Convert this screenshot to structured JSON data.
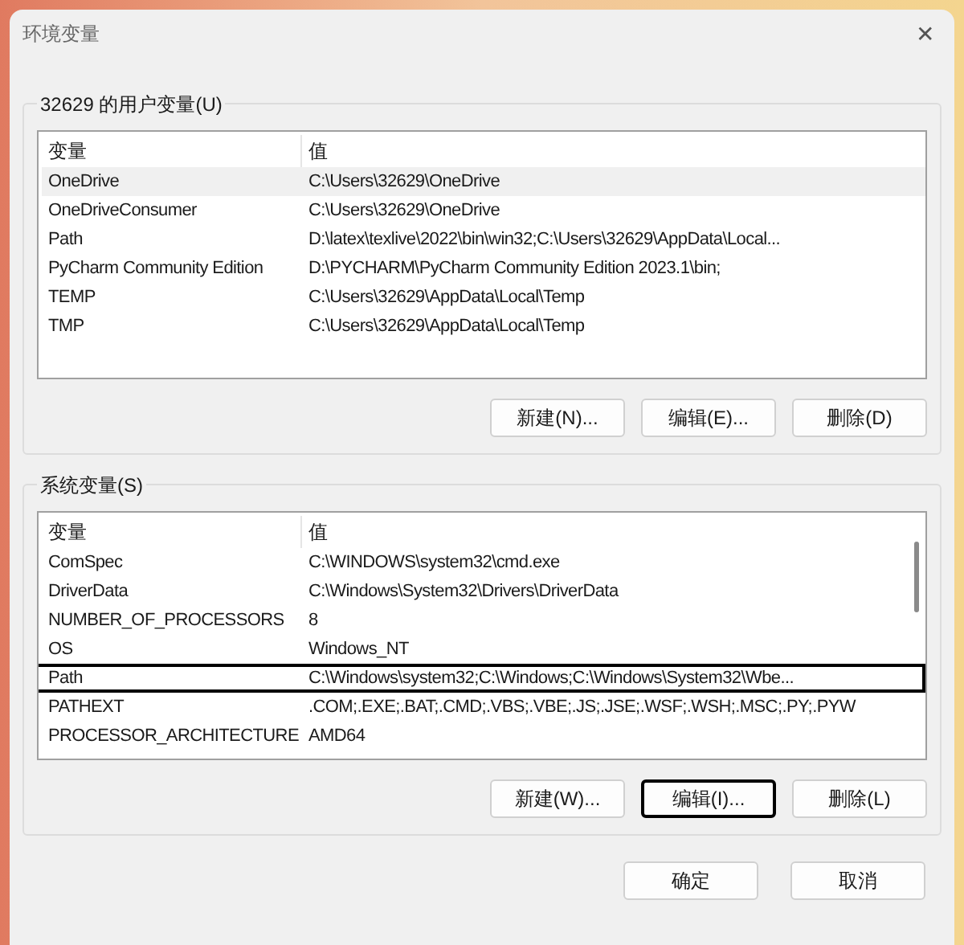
{
  "window": {
    "title": "环境变量",
    "close": "✕"
  },
  "user_group": {
    "title": "32629 的用户变量(U)",
    "columns": [
      "变量",
      "值"
    ],
    "rows": [
      {
        "name": "OneDrive",
        "value": "C:\\Users\\32629\\OneDrive",
        "selected": true
      },
      {
        "name": "OneDriveConsumer",
        "value": "C:\\Users\\32629\\OneDrive",
        "selected": false
      },
      {
        "name": "Path",
        "value": "D:\\latex\\texlive\\2022\\bin\\win32;C:\\Users\\32629\\AppData\\Local...",
        "selected": false
      },
      {
        "name": "PyCharm Community Edition",
        "value": "D:\\PYCHARM\\PyCharm Community Edition 2023.1\\bin;",
        "selected": false
      },
      {
        "name": "TEMP",
        "value": "C:\\Users\\32629\\AppData\\Local\\Temp",
        "selected": false
      },
      {
        "name": "TMP",
        "value": "C:\\Users\\32629\\AppData\\Local\\Temp",
        "selected": false
      }
    ],
    "buttons": [
      {
        "label": "新建(N)...",
        "focused": false
      },
      {
        "label": "编辑(E)...",
        "focused": false
      },
      {
        "label": "删除(D)",
        "focused": false
      }
    ]
  },
  "system_group": {
    "title": "系统变量(S)",
    "columns": [
      "变量",
      "值"
    ],
    "rows": [
      {
        "name": "ComSpec",
        "value": "C:\\WINDOWS\\system32\\cmd.exe",
        "selected": false
      },
      {
        "name": "DriverData",
        "value": "C:\\Windows\\System32\\Drivers\\DriverData",
        "selected": false
      },
      {
        "name": "NUMBER_OF_PROCESSORS",
        "value": "8",
        "selected": false
      },
      {
        "name": "OS",
        "value": "Windows_NT",
        "selected": false
      },
      {
        "name": "Path",
        "value": "C:\\Windows\\system32;C:\\Windows;C:\\Windows\\System32\\Wbe...",
        "selected": true
      },
      {
        "name": "PATHEXT",
        "value": ".COM;.EXE;.BAT;.CMD;.VBS;.VBE;.JS;.JSE;.WSF;.WSH;.MSC;.PY;.PYW",
        "selected": false
      },
      {
        "name": "PROCESSOR_ARCHITECTURE",
        "value": "AMD64",
        "selected": false
      }
    ],
    "buttons": [
      {
        "label": "新建(W)...",
        "focused": false
      },
      {
        "label": "编辑(I)...",
        "focused": true
      },
      {
        "label": "删除(L)",
        "focused": false
      }
    ]
  },
  "footer_buttons": [
    {
      "label": "确定",
      "focused": false
    },
    {
      "label": "取消",
      "focused": false
    }
  ]
}
